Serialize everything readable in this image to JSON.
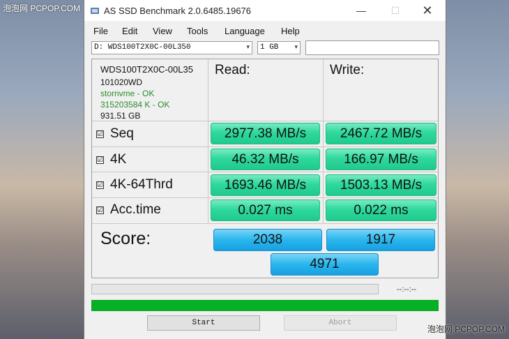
{
  "watermark": {
    "top": "泡泡网 PCPOP.COM",
    "bottom": "泡泡网 PCPOP.COM"
  },
  "window": {
    "title": "AS SSD Benchmark 2.0.6485.19676",
    "minimize": "—",
    "maximize": "☐",
    "close": "✕"
  },
  "menu": [
    "File",
    "Edit",
    "View",
    "Tools",
    "Language",
    "Help"
  ],
  "toolbar": {
    "drive": "D: WDS100T2X0C-00L350",
    "size": "1 GB",
    "arrow": "▾"
  },
  "drive_info": {
    "name": "WDS100T2X0C-00L35",
    "firmware": "101020WD",
    "driver": "stornvme - OK",
    "alignment": "315203584 K - OK",
    "capacity": "931.51 GB"
  },
  "headers": {
    "read": "Read:",
    "write": "Write:"
  },
  "check_mark": "☑",
  "tests": [
    {
      "label": "Seq",
      "read": "2977.38 MB/s",
      "write": "2467.72 MB/s"
    },
    {
      "label": "4K",
      "read": "46.32 MB/s",
      "write": "166.97 MB/s"
    },
    {
      "label": "4K-64Thrd",
      "read": "1693.46 MB/s",
      "write": "1503.13 MB/s"
    },
    {
      "label": "Acc.time",
      "read": "0.027 ms",
      "write": "0.022 ms"
    }
  ],
  "score": {
    "label": "Score:",
    "read": "2038",
    "write": "1917",
    "total": "4971"
  },
  "status": {
    "time": "--:--:--",
    "progress_fraction": 0.0,
    "overall_fraction": 1.0
  },
  "buttons": {
    "start": "Start",
    "abort": "Abort"
  },
  "colors": {
    "result": "#2fd99d",
    "score": "#29b6ee",
    "progress": "#06b025"
  }
}
